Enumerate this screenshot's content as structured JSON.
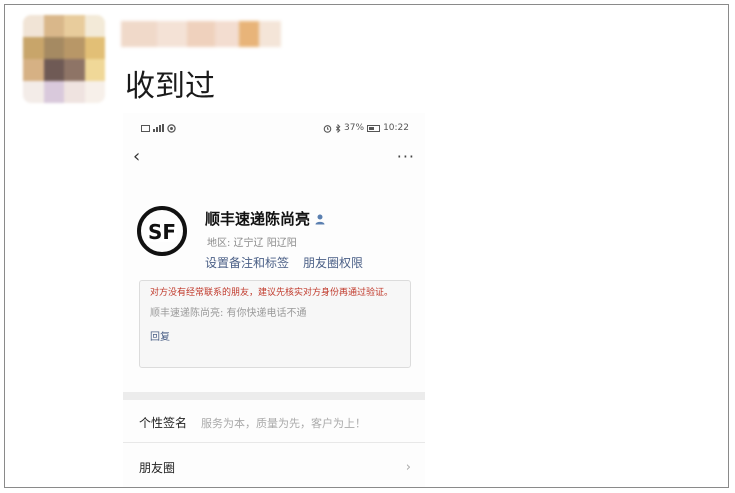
{
  "post": {
    "caption": "收到过"
  },
  "screenshot": {
    "status_bar": {
      "signal_text": "ᴴᴰ",
      "battery_percent": "37%",
      "time": "10:22"
    },
    "nav": {
      "back_glyph": "‹",
      "more_glyph": "···"
    },
    "profile": {
      "logo_text": "SF",
      "name": "顺丰速递陈尚亮",
      "region": "地区: 辽宁辽 阳辽阳",
      "links": [
        "设置备注和标签",
        "朋友圈权限"
      ]
    },
    "notice": {
      "warning": "对方没有经常联系的朋友，建议先核实对方身份再通过验证。",
      "message": "顺丰速递陈尚亮: 有你快递电话不通",
      "reply_label": "回复"
    },
    "rows": {
      "signature_label": "个性签名",
      "signature_value": "服务为本，质量为先，客户为上！",
      "moments_label": "朋友圈",
      "moments_chevron": "›"
    }
  },
  "colors": {
    "link": "#4a5f86",
    "warning": "#c0392b",
    "muted": "#9a9a9a"
  },
  "icons": [
    "sim-icon",
    "signal-icon",
    "wifi-icon",
    "alarm-icon",
    "bluetooth-icon",
    "battery-icon",
    "back-icon",
    "more-icon",
    "sf-logo",
    "person-icon",
    "chevron-right-icon"
  ]
}
